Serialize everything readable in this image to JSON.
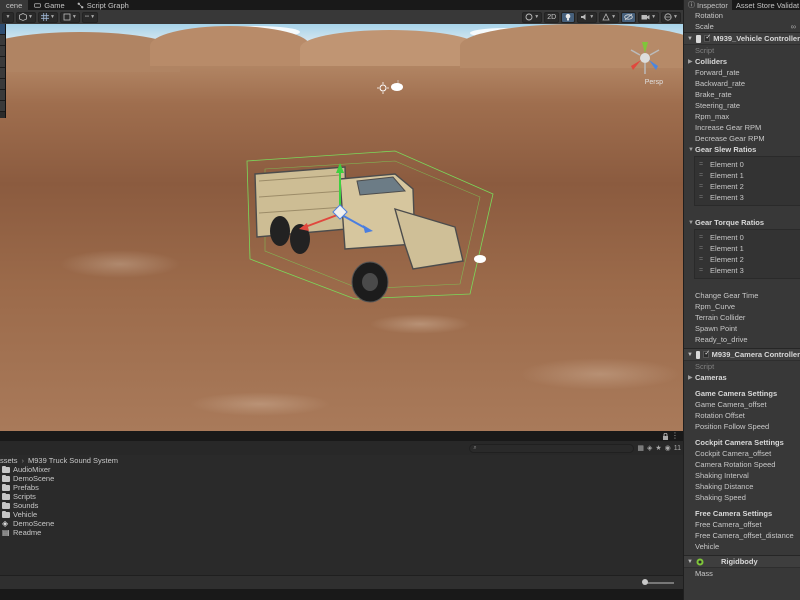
{
  "tabs": {
    "scene": "cene",
    "game": "Game",
    "script_graph": "Script Graph"
  },
  "toolbar": {
    "mode_2d": "2D"
  },
  "scene_view": {
    "camera_label": "Persp"
  },
  "project": {
    "breadcrumb_root": "ssets",
    "breadcrumb_folder": "M939 Truck Sound System",
    "visible_count": "11",
    "items": [
      {
        "label": "AudioMixer",
        "icon": "folder-icon"
      },
      {
        "label": "DemoScene",
        "icon": "folder-icon"
      },
      {
        "label": "Prefabs",
        "icon": "folder-icon"
      },
      {
        "label": "Scripts",
        "icon": "folder-icon"
      },
      {
        "label": "Sounds",
        "icon": "folder-icon"
      },
      {
        "label": "Vehicle",
        "icon": "folder-icon"
      },
      {
        "label": "DemoScene",
        "icon": "unity-scene-icon"
      },
      {
        "label": "Readme",
        "icon": "text-file-icon"
      }
    ]
  },
  "inspector": {
    "tab_inspector": "Inspector",
    "tab_asset_store": "Asset Store Validat",
    "transform_rows": [
      "Rotation",
      "Scale"
    ],
    "vehicle_controller": {
      "title": "M939_Vehicle Controller",
      "script_label": "Script",
      "colliders": "Colliders",
      "fields": [
        "Forward_rate",
        "Backward_rate",
        "Brake_rate",
        "Steering_rate",
        "Rpm_max",
        "Increase Gear RPM",
        "Decrease Gear RPM"
      ],
      "slew_title": "Gear Slew Ratios",
      "slew_elements": [
        "Element 0",
        "Element 1",
        "Element 2",
        "Element 3"
      ],
      "torque_title": "Gear Torque Ratios",
      "torque_elements": [
        "Element 0",
        "Element 1",
        "Element 2",
        "Element 3"
      ],
      "fields2": [
        "Change Gear Time",
        "Rpm_Curve",
        "Terrain Collider",
        "Spawn Point",
        "Ready_to_drive"
      ]
    },
    "camera_controller": {
      "title": "M939_Camera Controller",
      "script_label": "Script",
      "cameras": "Cameras",
      "game_title": "Game Camera Settings",
      "game_fields": [
        "Game Camera_offset",
        "Rotation Offset",
        "Position Follow Speed"
      ],
      "cockpit_title": "Cockpit Camera Settings",
      "cockpit_fields": [
        "Cockpit Camera_offset",
        "Camera Rotation Speed",
        "Shaking Interval",
        "Shaking Distance",
        "Shaking Speed"
      ],
      "free_title": "Free Camera Settings",
      "free_fields": [
        "Free Camera_offset",
        "Free Camera_offset_distance",
        "Vehicle"
      ]
    },
    "rigidbody": {
      "title": "Rigidbody",
      "fields": [
        "Mass"
      ]
    }
  }
}
